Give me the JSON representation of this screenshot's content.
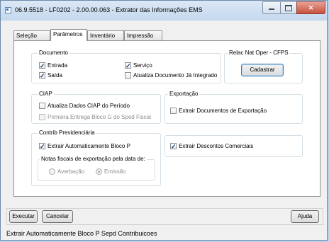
{
  "window": {
    "title": "06.9.5518 - LF0202 - 2.00.00.063 - Extrator das Informações EMS"
  },
  "titlebar_buttons": {
    "close": "✕"
  },
  "tabs": [
    {
      "label": "Seleção"
    },
    {
      "label": "Parâmetros",
      "active": true
    },
    {
      "label": "Inventário"
    },
    {
      "label": "Impressão"
    }
  ],
  "documento": {
    "legend": "Documento",
    "entrada": {
      "label": "Entrada",
      "checked": true
    },
    "saida": {
      "label": "Saída",
      "checked": true
    },
    "servico": {
      "label": "Serviço",
      "checked": true
    },
    "atualiza_documento": {
      "label": "Atualiza Documento Já Integrado",
      "checked": false
    }
  },
  "relac": {
    "legend": "Relac Nat Oper - CFPS",
    "cadastrar_label": "Cadastrar"
  },
  "ciap": {
    "legend": "CIAP",
    "atualiza_dados": {
      "label": "Atualiza Dados CIAP do Período",
      "checked": false
    },
    "primeira_entrega": {
      "label": "Primeira Entrega Bloco G do Sped Fiscal",
      "checked": false,
      "disabled": true
    }
  },
  "exportacao": {
    "legend": "Exportação",
    "extrair_docs": {
      "label": "Extrair Documentos de Exportação",
      "checked": false
    }
  },
  "contrib": {
    "legend": "Contrib Previdenciária",
    "extrair_bloco_p": {
      "label": "Extrair Automaticamente Bloco P",
      "checked": true
    },
    "notas": {
      "legend": "Notas fiscais de exportação pela data de:",
      "averbacao": {
        "label": "Averbação",
        "selected": false
      },
      "emissao": {
        "label": "Emissão",
        "selected": true
      }
    }
  },
  "descontos": {
    "label": "Extrair Descontos Comerciais",
    "checked": true
  },
  "footer": {
    "executar": "Executar",
    "cancelar": "Cancelar",
    "ajuda": "Ajuda"
  },
  "status_text": "Extrair Automaticamente Bloco P Sepd Contribuicoes",
  "check_mark": "✓"
}
